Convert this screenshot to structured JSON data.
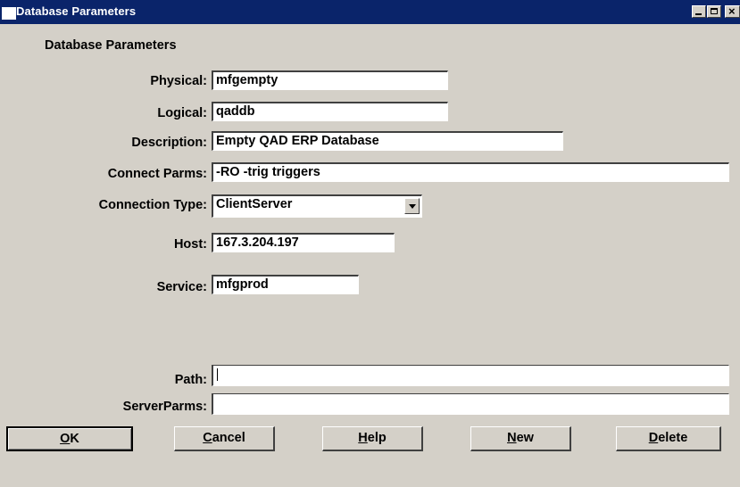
{
  "window": {
    "title": "Database Parameters",
    "controls": {
      "minimize": "minimize-icon",
      "maximize": "maximize-icon",
      "close": "close-icon"
    }
  },
  "form": {
    "group_title": "Database Parameters",
    "fields": {
      "physical": {
        "label": "Physical:",
        "value": "mfgempty"
      },
      "logical": {
        "label": "Logical:",
        "value": "qaddb"
      },
      "description": {
        "label": "Description:",
        "value": "Empty QAD ERP Database"
      },
      "connect_parms": {
        "label": "Connect Parms:",
        "value": "-RO -trig triggers"
      },
      "connection_type": {
        "label": "Connection Type:",
        "value": "ClientServer"
      },
      "host": {
        "label": "Host:",
        "value": "167.3.204.197"
      },
      "service": {
        "label": "Service:",
        "value": "mfgprod"
      },
      "path": {
        "label": "Path:",
        "value": ""
      },
      "server_parms": {
        "label": "ServerParms:",
        "value": ""
      }
    }
  },
  "buttons": {
    "ok": {
      "first": "O",
      "rest": "K"
    },
    "cancel": {
      "first": "C",
      "rest": "ancel"
    },
    "help": {
      "first": "H",
      "rest": "elp"
    },
    "new": {
      "first": "N",
      "rest": "ew"
    },
    "delete": {
      "first": "D",
      "rest": "elete"
    }
  },
  "colors": {
    "titlebar": "#0a246a",
    "face": "#d4d0c8",
    "field": "#ffffff"
  }
}
